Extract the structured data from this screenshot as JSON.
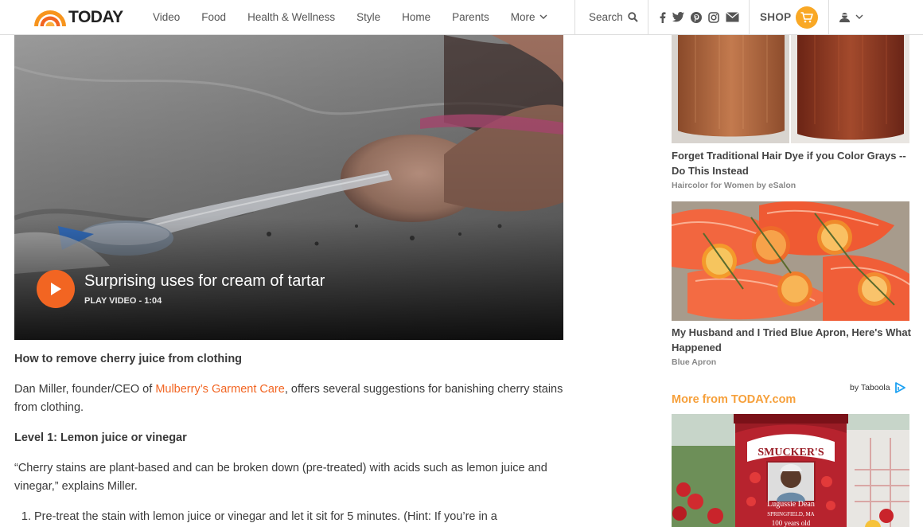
{
  "header": {
    "logo_text": "TODAY",
    "nav": [
      "Video",
      "Food",
      "Health & Wellness",
      "Style",
      "Home",
      "Parents"
    ],
    "more_label": "More",
    "search_label": "Search",
    "shop_label": "SHOP",
    "social_icons": [
      "facebook-icon",
      "twitter-icon",
      "pinterest-icon",
      "instagram-icon",
      "email-icon"
    ]
  },
  "video": {
    "title": "Surprising uses for cream of tartar",
    "meta": "PLAY VIDEO - 1:04"
  },
  "article": {
    "heading": "How to remove cherry juice from clothing",
    "para1_pre": "Dan Miller, founder/CEO of ",
    "para1_link": "Mulberry’s Garment Care",
    "para1_post": ", offers several suggestions for banishing cherry stains from clothing.",
    "level1": "Level 1: Lemon juice or vinegar",
    "quote": "“Cherry stains are plant-based and can be broken down (pre-treated) with acids such as lemon juice and vinegar,” explains Miller.",
    "step1": "Pre-treat the stain with lemon juice or vinegar and let it sit for 5 minutes. (Hint: If you’re in a"
  },
  "sidebar": {
    "ads": [
      {
        "title": "Forget Traditional Hair Dye if you Color Grays -- Do This Instead",
        "source": "Haircolor for Women by eSalon"
      },
      {
        "title": "My Husband and I Tried Blue Apron, Here's What Happened",
        "source": "Blue Apron"
      }
    ],
    "taboola": "by Taboola",
    "more_from": "More from TODAY.com",
    "jar_brand": "SMUCKER'S",
    "jar_name": "Lugussie Dean",
    "jar_place": "SPRINGFIELD, MA",
    "jar_age": "100 years old"
  },
  "colors": {
    "brand_orange": "#f26522",
    "shop_yellow": "#f9a825",
    "taboola_blue": "#1da1f2"
  }
}
